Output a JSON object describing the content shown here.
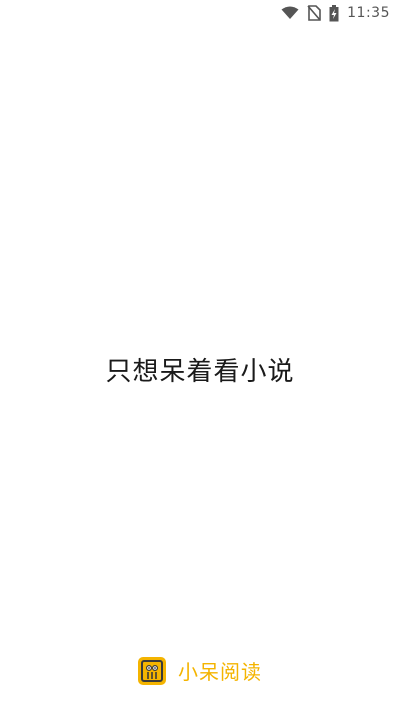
{
  "status_bar": {
    "time": "11:35",
    "icons": [
      "wifi-icon",
      "no-sim-icon",
      "battery-charging-icon"
    ]
  },
  "splash": {
    "slogan": "只想呆着看小说"
  },
  "brand": {
    "app_name": "小呆阅读",
    "logo_icon": "app-logo-icon",
    "accent_color": "#f4b400"
  }
}
